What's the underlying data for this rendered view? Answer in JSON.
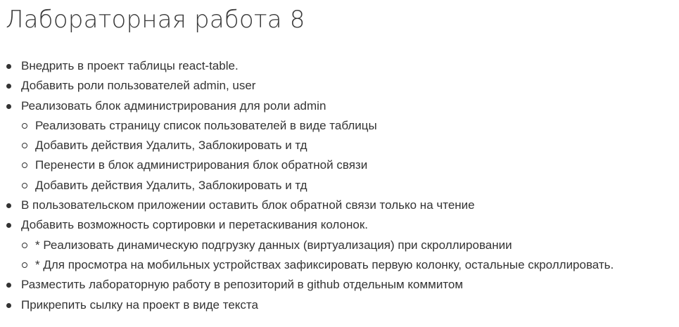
{
  "title": "Лабораторная работа 8",
  "items": [
    {
      "text": "Внедрить в проект  таблицы react-table."
    },
    {
      "text": "Добавить роли пользователей admin, user"
    },
    {
      "text": "Реализовать блок администрирования для роли admin",
      "children": [
        "Реализовать страницу список пользователей в виде таблицы",
        "Добавить действия Удалить, Заблокировать и тд",
        "Перенести в блок администрирования блок обратной связи",
        "Добавить действия Удалить, Заблокировать и тд"
      ]
    },
    {
      "text": "В пользовательском приложении оставить блок обратной связи только на чтение"
    },
    {
      "text": "Добавить возможность сортировки и перетаскивания колонок.",
      "children": [
        "* Реализовать динамическую подгрузку данных (виртуализация) при скроллировании",
        "* Для просмотра на мобильных устройствах зафиксировать первую колонку, остальные скроллировать."
      ]
    },
    {
      "text": "Разместить лабораторную работу в репозиторий в github отдельным коммитом"
    },
    {
      "text": "Прикрепить  сылку на проект в виде текста"
    }
  ]
}
